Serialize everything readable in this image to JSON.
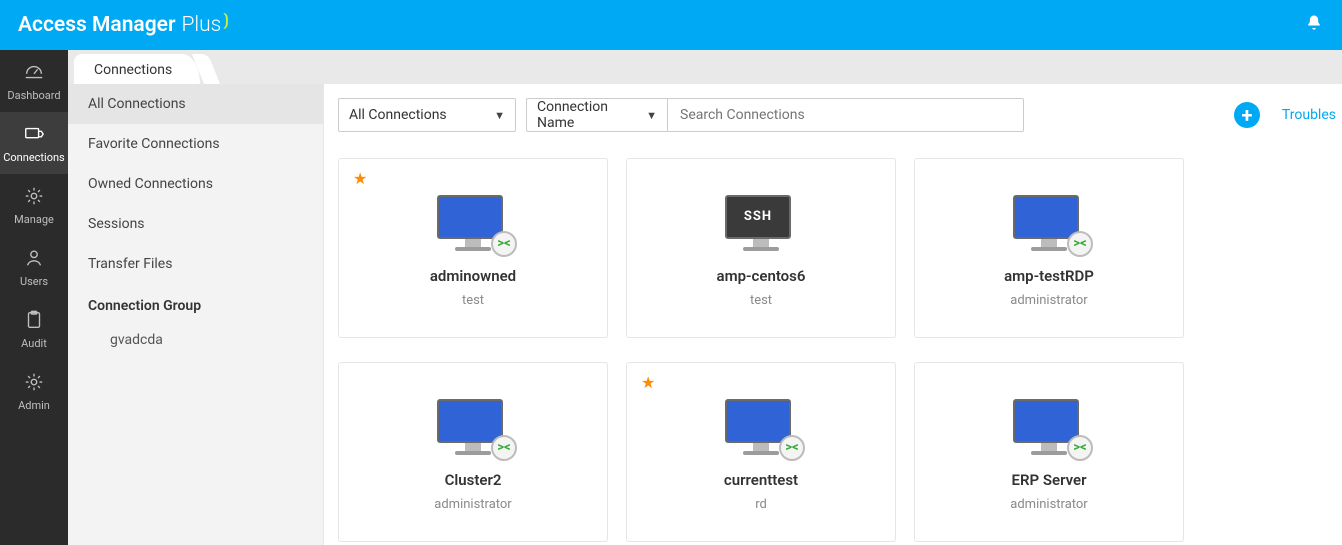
{
  "brand": {
    "name": "Access Manager",
    "suffix": "Plus"
  },
  "nav": {
    "items": [
      {
        "label": "Dashboard"
      },
      {
        "label": "Connections"
      },
      {
        "label": "Manage"
      },
      {
        "label": "Users"
      },
      {
        "label": "Audit"
      },
      {
        "label": "Admin"
      }
    ]
  },
  "tab": {
    "label": "Connections"
  },
  "subside": {
    "items": [
      {
        "label": "All Connections"
      },
      {
        "label": "Favorite Connections"
      },
      {
        "label": "Owned Connections"
      },
      {
        "label": "Sessions"
      },
      {
        "label": "Transfer Files"
      }
    ],
    "group_header": "Connection Group",
    "groups": [
      {
        "label": "gvadcda"
      }
    ]
  },
  "toolbar": {
    "filter_label": "All Connections",
    "field_label": "Connection Name",
    "search_placeholder": "Search Connections",
    "troubleshoot_label": "Troubles"
  },
  "cards": [
    {
      "name": "adminowned",
      "user": "test",
      "type": "rdp",
      "favorite": true
    },
    {
      "name": "amp-centos6",
      "user": "test",
      "type": "ssh",
      "favorite": false
    },
    {
      "name": "amp-testRDP",
      "user": "administrator",
      "type": "rdp",
      "favorite": false
    },
    {
      "name": "Cluster2",
      "user": "administrator",
      "type": "rdp",
      "favorite": false
    },
    {
      "name": "currenttest",
      "user": "rd",
      "type": "rdp",
      "favorite": true
    },
    {
      "name": "ERP Server",
      "user": "administrator",
      "type": "rdp",
      "favorite": false
    }
  ],
  "ssh_label": "SSH"
}
